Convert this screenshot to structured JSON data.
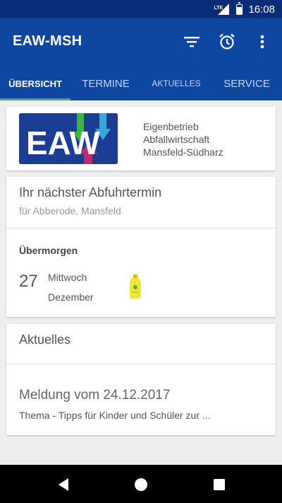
{
  "status": {
    "network": "LTE",
    "time": "16:08"
  },
  "app": {
    "title": "EAW-MSH",
    "actions": [
      "filter-icon",
      "alarm-icon",
      "more-vert-icon"
    ]
  },
  "tabs": [
    {
      "label": "ÜBERSICHT",
      "active": true
    },
    {
      "label": "TERMINE"
    },
    {
      "label": "AKTUELLES"
    },
    {
      "label": "SERVICE"
    }
  ],
  "org": {
    "logo_text": "EAW",
    "line1": "Eigenbetrieb",
    "line2": "Abfallwirtschaft",
    "line3": "Mansfeld-Südharz"
  },
  "next_pickup": {
    "title": "Ihr nächster Abfuhrtermin",
    "location": "für  Abberode, Mansfeld",
    "relative_day": "Übermorgen",
    "day": "27",
    "weekday": "Mittwoch",
    "month": "Dezember",
    "bin_icon": "yellow-bag-icon"
  },
  "news": {
    "header": "Aktuelles",
    "title": "Meldung vom 24.12.2017",
    "subtitle": "Thema - Tipps für Kinder und Schüler zur ..."
  },
  "colors": {
    "primary": "#0d47a1",
    "status_bar": "#0a2d7a",
    "tab_indicator": "#4caf50"
  },
  "nav": [
    "back-icon",
    "home-icon",
    "recents-icon"
  ]
}
